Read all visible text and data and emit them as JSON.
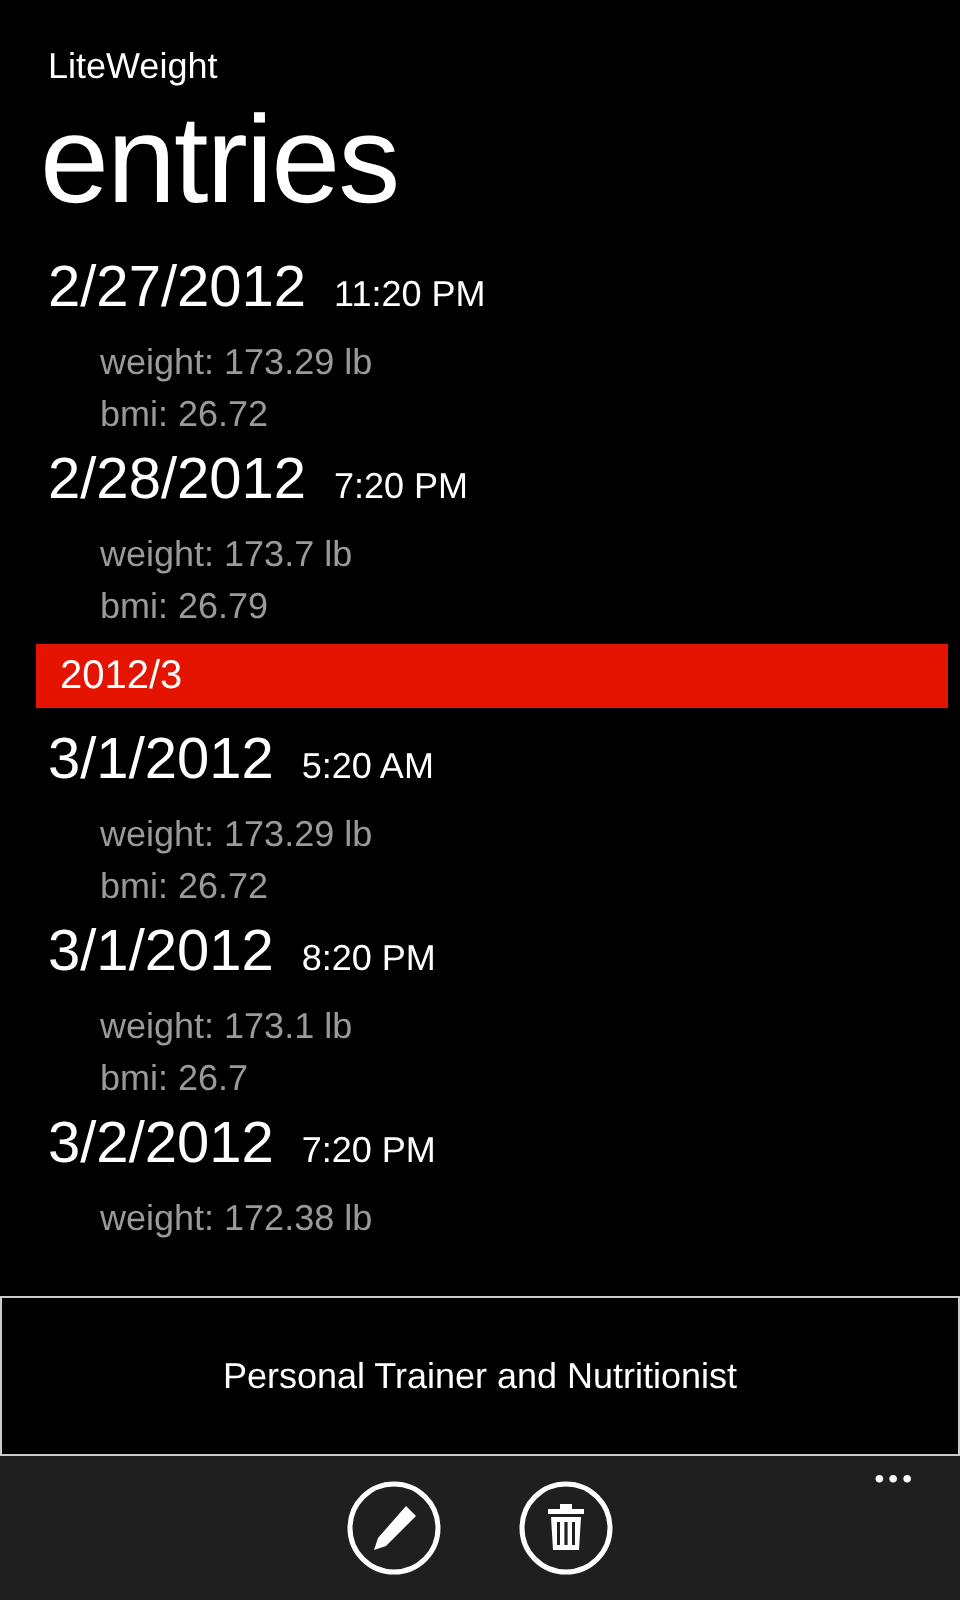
{
  "app_title": "LiteWeight",
  "page_title": "entries",
  "items": [
    {
      "kind": "entry",
      "date": "2/27/2012",
      "time": "11:20 PM",
      "weight": "weight: 173.29 lb",
      "bmi": "bmi: 26.72"
    },
    {
      "kind": "entry",
      "date": "2/28/2012",
      "time": "7:20 PM",
      "weight": "weight: 173.7 lb",
      "bmi": "bmi: 26.79"
    },
    {
      "kind": "group",
      "label": "2012/3"
    },
    {
      "kind": "entry",
      "date": "3/1/2012",
      "time": "5:20 AM",
      "weight": "weight: 173.29 lb",
      "bmi": "bmi: 26.72"
    },
    {
      "kind": "entry",
      "date": "3/1/2012",
      "time": "8:20 PM",
      "weight": "weight: 173.1 lb",
      "bmi": "bmi: 26.7"
    },
    {
      "kind": "entry",
      "date": "3/2/2012",
      "time": "7:20 PM",
      "weight": "weight: 172.38 lb"
    }
  ],
  "ad": {
    "text": "Personal Trainer and Nutritionist"
  },
  "app_bar": {
    "buttons": [
      {
        "kind": "edit"
      },
      {
        "kind": "delete"
      }
    ],
    "more": "•••"
  }
}
